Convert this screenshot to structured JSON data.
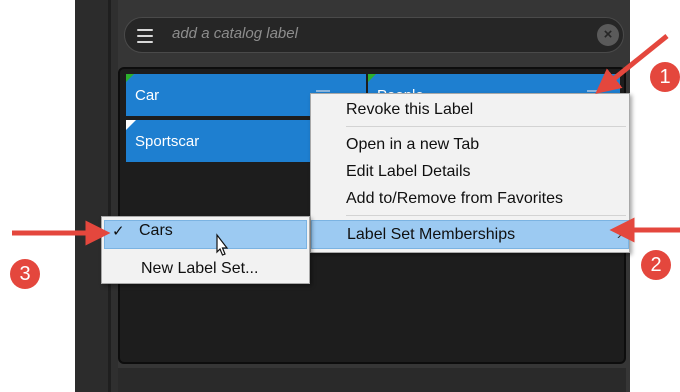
{
  "search": {
    "placeholder": "add a catalog label",
    "clear_icon": "×"
  },
  "tiles": [
    {
      "label": "Car"
    },
    {
      "label": "Sportscar"
    },
    {
      "label": "People"
    }
  ],
  "context_menu": {
    "items": [
      {
        "label": "Revoke this Label"
      },
      {
        "label": "Open in a new Tab"
      },
      {
        "label": "Edit Label Details"
      },
      {
        "label": "Add to/Remove from Favorites"
      },
      {
        "label": "Label Set Memberships"
      }
    ],
    "submenu_arrow": "›"
  },
  "submenu": {
    "items": [
      {
        "label": "Cars",
        "checked": true,
        "check_mark": "✓"
      },
      {
        "label": "New Label Set..."
      }
    ]
  },
  "annotations": {
    "badges": [
      "1",
      "2",
      "3"
    ],
    "color": "#e4473d"
  },
  "colors": {
    "tile_blue": "#1e7fd0",
    "highlight": "#9ccaf2",
    "panel_bg": "#1d1d1d"
  }
}
